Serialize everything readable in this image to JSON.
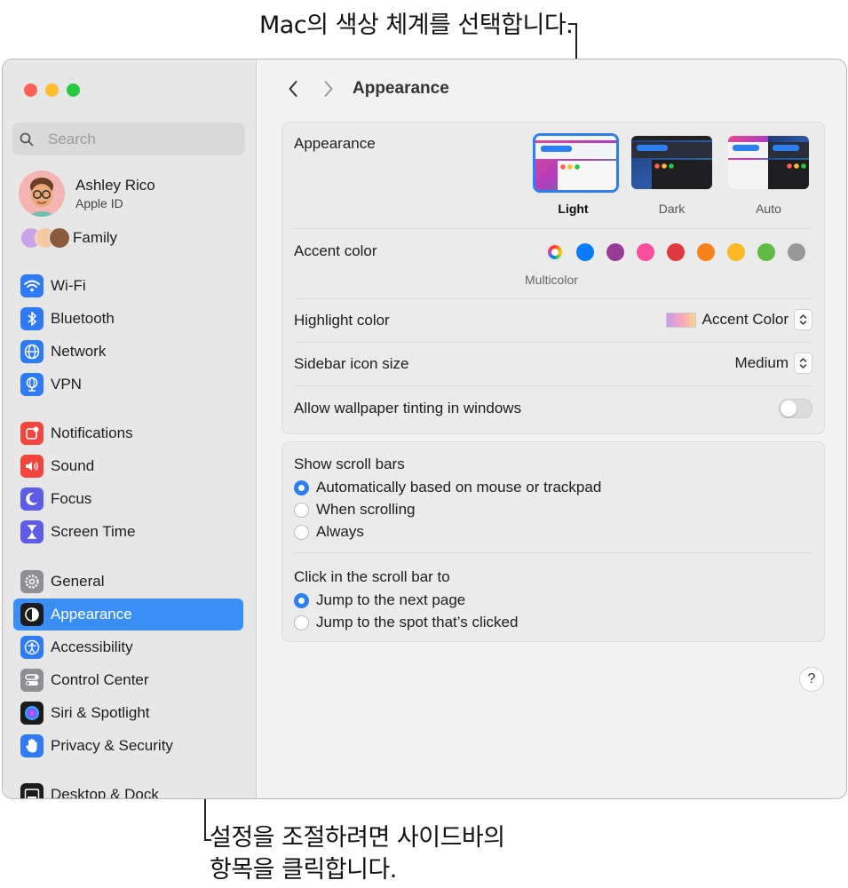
{
  "callouts": {
    "top": "Mac의 색상 체계를 선택합니다.",
    "bottom_line1": "설정을 조절하려면 사이드바의",
    "bottom_line2": "항목을 클릭합니다."
  },
  "window": {
    "title": "Appearance",
    "traffic_lights": {
      "close": "#ff5f57",
      "minimize": "#febc2e",
      "zoom": "#28c840"
    }
  },
  "sidebar": {
    "search_placeholder": "Search",
    "profile": {
      "name": "Ashley Rico",
      "subtitle": "Apple ID"
    },
    "family_label": "Family",
    "items": [
      {
        "label": "Wi-Fi",
        "icon": "wifi-icon",
        "color": "#2f7bf6"
      },
      {
        "label": "Bluetooth",
        "icon": "bluetooth-icon",
        "color": "#2f7bf6"
      },
      {
        "label": "Network",
        "icon": "globe-icon",
        "color": "#2f7bf6"
      },
      {
        "label": "VPN",
        "icon": "vpn-globe-icon",
        "color": "#2f7bf6"
      },
      {
        "label": "Notifications",
        "icon": "bell-icon",
        "color": "#f1453d"
      },
      {
        "label": "Sound",
        "icon": "speaker-icon",
        "color": "#f1453d"
      },
      {
        "label": "Focus",
        "icon": "moon-icon",
        "color": "#5e5ce6"
      },
      {
        "label": "Screen Time",
        "icon": "hourglass-icon",
        "color": "#5e5ce6"
      },
      {
        "label": "General",
        "icon": "gear-icon",
        "color": "#8e8e93"
      },
      {
        "label": "Appearance",
        "icon": "appearance-icon",
        "color": "#1c1c1e"
      },
      {
        "label": "Accessibility",
        "icon": "accessibility-icon",
        "color": "#2f7bf6"
      },
      {
        "label": "Control Center",
        "icon": "control-center-icon",
        "color": "#8e8e93"
      },
      {
        "label": "Siri & Spotlight",
        "icon": "siri-icon",
        "color": "#1c1c1e"
      },
      {
        "label": "Privacy & Security",
        "icon": "hand-icon",
        "color": "#2f7bf6"
      },
      {
        "label": "Desktop & Dock",
        "icon": "dock-icon",
        "color": "#1c1c1e"
      }
    ],
    "active_item": "Appearance"
  },
  "appearance": {
    "label": "Appearance",
    "options": [
      {
        "label": "Light",
        "selected": true
      },
      {
        "label": "Dark",
        "selected": false
      },
      {
        "label": "Auto",
        "selected": false
      }
    ]
  },
  "accent": {
    "label": "Accent color",
    "selected_name": "Multicolor",
    "colors": [
      "multicolor",
      "#0a7aff",
      "#953d96",
      "#f74f9e",
      "#e0383e",
      "#f7821b",
      "#fcb827",
      "#62ba46",
      "#989898"
    ]
  },
  "highlight": {
    "label": "Highlight color",
    "value": "Accent Color"
  },
  "sidebar_icon_size": {
    "label": "Sidebar icon size",
    "value": "Medium"
  },
  "wallpaper_tinting": {
    "label": "Allow wallpaper tinting in windows",
    "enabled": false
  },
  "scroll_bars": {
    "label": "Show scroll bars",
    "options": [
      {
        "label": "Automatically based on mouse or trackpad",
        "selected": true
      },
      {
        "label": "When scrolling",
        "selected": false
      },
      {
        "label": "Always",
        "selected": false
      }
    ]
  },
  "click_scroll": {
    "label": "Click in the scroll bar to",
    "options": [
      {
        "label": "Jump to the next page",
        "selected": true
      },
      {
        "label": "Jump to the spot that’s clicked",
        "selected": false
      }
    ]
  },
  "help_label": "?"
}
